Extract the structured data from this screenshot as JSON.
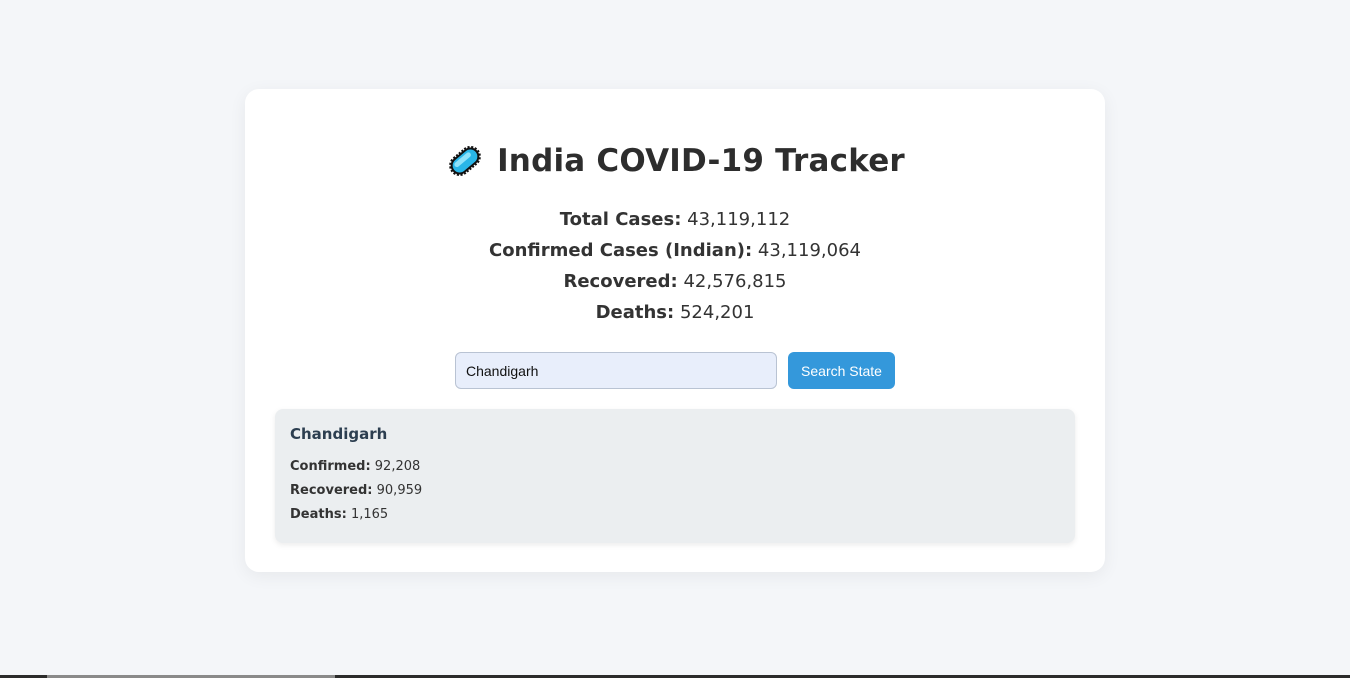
{
  "header": {
    "icon": "pill-icon",
    "title": "India COVID-19 Tracker"
  },
  "stats": {
    "total_label": "Total Cases:",
    "total_value": "43,119,112",
    "confirmed_label": "Confirmed Cases (Indian):",
    "confirmed_value": "43,119,064",
    "recovered_label": "Recovered:",
    "recovered_value": "42,576,815",
    "deaths_label": "Deaths:",
    "deaths_value": "524,201"
  },
  "search": {
    "value": "Chandigarh",
    "button_label": "Search State"
  },
  "result": {
    "state": "Chandigarh",
    "confirmed_label": "Confirmed:",
    "confirmed_value": "92,208",
    "recovered_label": "Recovered:",
    "recovered_value": "90,959",
    "deaths_label": "Deaths:",
    "deaths_value": "1,165"
  },
  "colors": {
    "accent": "#3498db",
    "page_background": "#f4f6f9",
    "panel_background": "#ebeef0"
  }
}
